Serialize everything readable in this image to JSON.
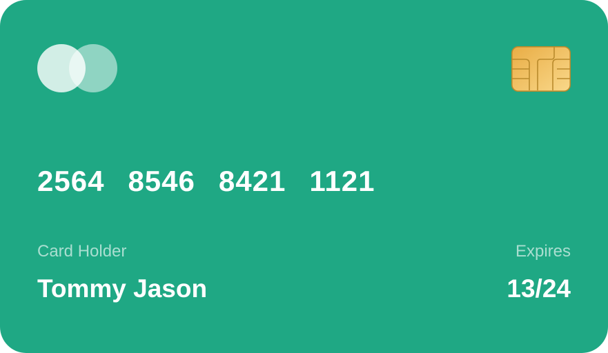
{
  "card": {
    "background_color": "#1fa884",
    "brand_icon": "mastercard-style-overlapping-circles-icon",
    "chip_icon": "emv-chip-icon",
    "number_groups": [
      "2564",
      "8546",
      "8421",
      "1121"
    ],
    "holder": {
      "label": "Card Holder",
      "name": "Tommy Jason"
    },
    "expiry": {
      "label": "Expires",
      "date": "13/24"
    }
  }
}
